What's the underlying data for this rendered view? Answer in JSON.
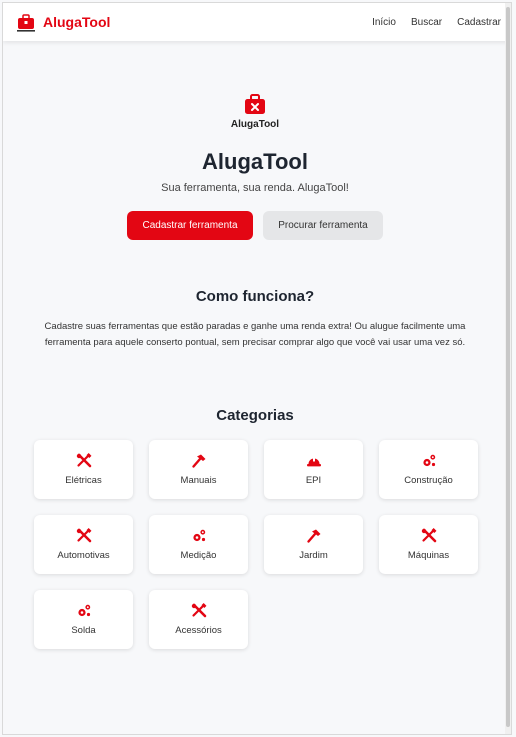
{
  "brand": {
    "name": "AlugaTool",
    "accent": "#e30613"
  },
  "nav": {
    "links": [
      "Início",
      "Buscar",
      "Cadastrar"
    ]
  },
  "hero": {
    "logo_text": "AlugaTool",
    "title": "AlugaTool",
    "subtitle": "Sua ferramenta, sua renda. AlugaTool!",
    "primary_button": "Cadastrar ferramenta",
    "secondary_button": "Procurar ferramenta"
  },
  "how": {
    "title": "Como funciona?",
    "text": "Cadastre suas ferramentas que estão paradas e ganhe uma renda extra! Ou alugue facilmente uma ferramenta para aquele conserto pontual, sem precisar comprar algo que você vai usar uma vez só."
  },
  "categories": {
    "title": "Categorias",
    "items": [
      {
        "label": "Elétricas",
        "icon": "tools-icon"
      },
      {
        "label": "Manuais",
        "icon": "hammer-icon"
      },
      {
        "label": "EPI",
        "icon": "hardhat-icon"
      },
      {
        "label": "Construção",
        "icon": "gears-icon"
      },
      {
        "label": "Automotivas",
        "icon": "tools-icon"
      },
      {
        "label": "Medição",
        "icon": "gears-icon"
      },
      {
        "label": "Jardim",
        "icon": "hammer-icon"
      },
      {
        "label": "Máquinas",
        "icon": "tools-icon"
      },
      {
        "label": "Solda",
        "icon": "gears-icon"
      },
      {
        "label": "Acessórios",
        "icon": "tools-icon"
      }
    ]
  }
}
